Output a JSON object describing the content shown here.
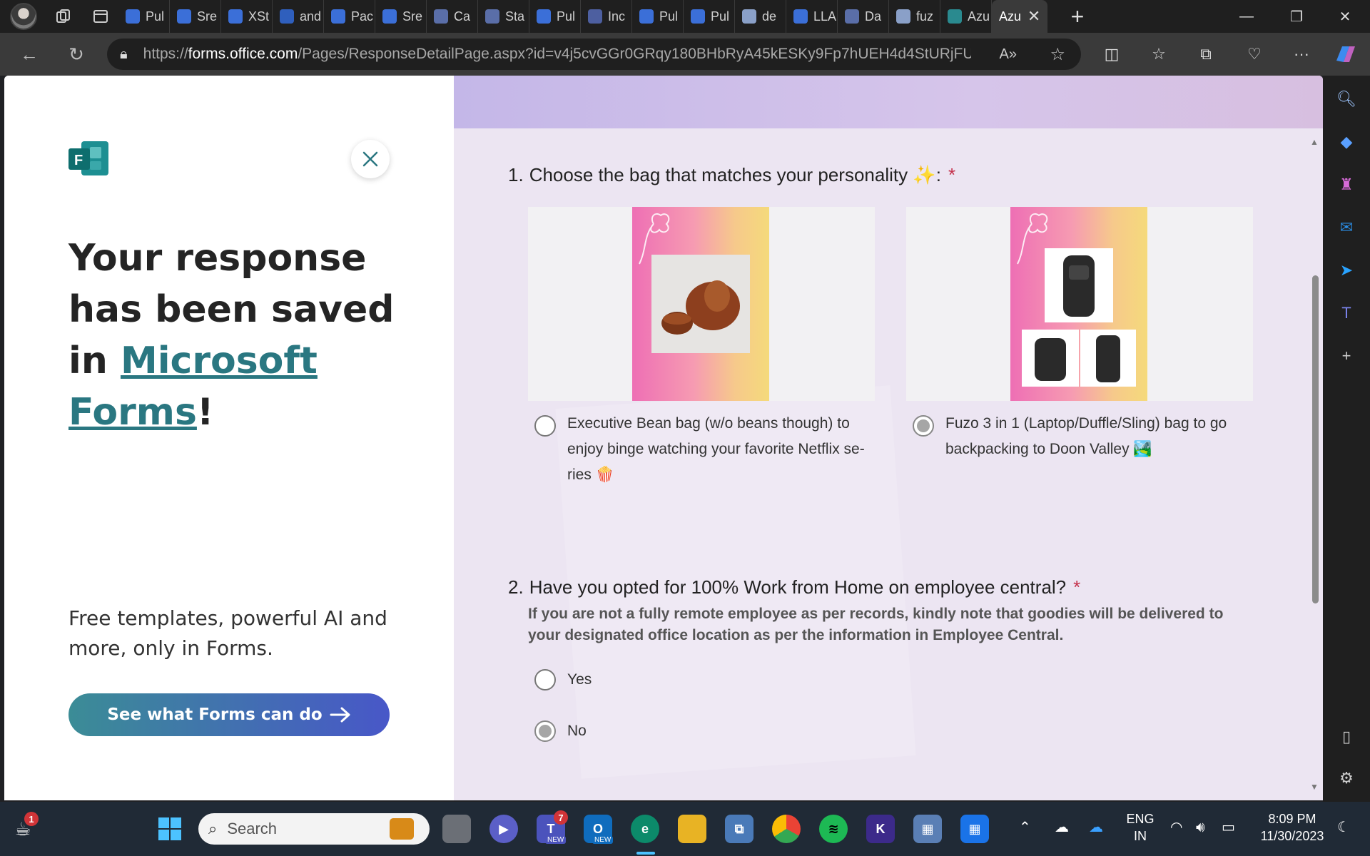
{
  "browser": {
    "tabs": [
      {
        "label": "Pul",
        "color": "#3b6fd8"
      },
      {
        "label": "Sre",
        "color": "#3b6fd8"
      },
      {
        "label": "XSt",
        "color": "#3b6fd8"
      },
      {
        "label": "and",
        "color": "#2f5fbd"
      },
      {
        "label": "Pac",
        "color": "#3b6fd8"
      },
      {
        "label": "Sre",
        "color": "#3b6fd8"
      },
      {
        "label": "Ca",
        "color": "#5a6ea8"
      },
      {
        "label": "Sta",
        "color": "#5a6ea8"
      },
      {
        "label": "Pul",
        "color": "#3b6fd8"
      },
      {
        "label": "Inc",
        "color": "#4d5fa0"
      },
      {
        "label": "Pul",
        "color": "#3b6fd8"
      },
      {
        "label": "Pul",
        "color": "#3b6fd8"
      },
      {
        "label": "de",
        "color": "#8aa0c8"
      },
      {
        "label": "LLA",
        "color": "#3b6fd8"
      },
      {
        "label": "Da",
        "color": "#5a6ea8"
      },
      {
        "label": "fuz",
        "color": "#8aa0c8"
      },
      {
        "label": "Azu",
        "color": "#2a8a8f"
      }
    ],
    "active_tab": {
      "label": "Azu"
    },
    "url_prefix": "https://",
    "url_domain": "forms.office.com",
    "url_rest": "/Pages/ResponseDetailPage.aspx?id=v4j5cvGGr0GRqy180BHbRyA45kESKy9Fp7hUEH4d4StURjFURU..."
  },
  "promo": {
    "headline_part1": "Your response has been saved in ",
    "headline_link": "Microsoft Forms",
    "headline_end": "!",
    "tagline": "Free templates, powerful AI and more, only in Forms.",
    "cta_label": "See what Forms can do",
    "logo_letter": "F"
  },
  "form": {
    "questions": [
      {
        "number": "1.",
        "title": "Choose the bag that matches your personality ✨:",
        "required_mark": "*",
        "options": [
          {
            "label": "Executive Bean bag (w/o beans though) to enjoy binge watching your favorite Netflix se-ries 🍿",
            "selected": false
          },
          {
            "label": "Fuzo 3 in 1 (Laptop/Duffle/Sling) bag to go backpacking to Doon Valley 🏞️",
            "selected": true
          }
        ]
      },
      {
        "number": "2.",
        "title": "Have you opted for 100% Work from Home on employee central?",
        "required_mark": "*",
        "subtitle": "If you are not a fully remote employee as per records, kindly note that goodies will be delivered to your designated office location as per the information in Employee Central.",
        "options": [
          {
            "label": "Yes",
            "selected": false
          },
          {
            "label": "No",
            "selected": true
          }
        ]
      }
    ]
  },
  "taskbar": {
    "search_placeholder": "Search",
    "teams_badge": "7",
    "weather_badge": "1",
    "teams_tag": "NEW",
    "outlook_tag": "NEW",
    "lang_line1": "ENG",
    "lang_line2": "IN",
    "time": "8:09 PM",
    "date": "11/30/2023"
  },
  "colors": {
    "accent_link": "#2a7781",
    "required": "#c4314b",
    "cta_start": "#3b8c96",
    "cta_end": "#4857c8"
  }
}
